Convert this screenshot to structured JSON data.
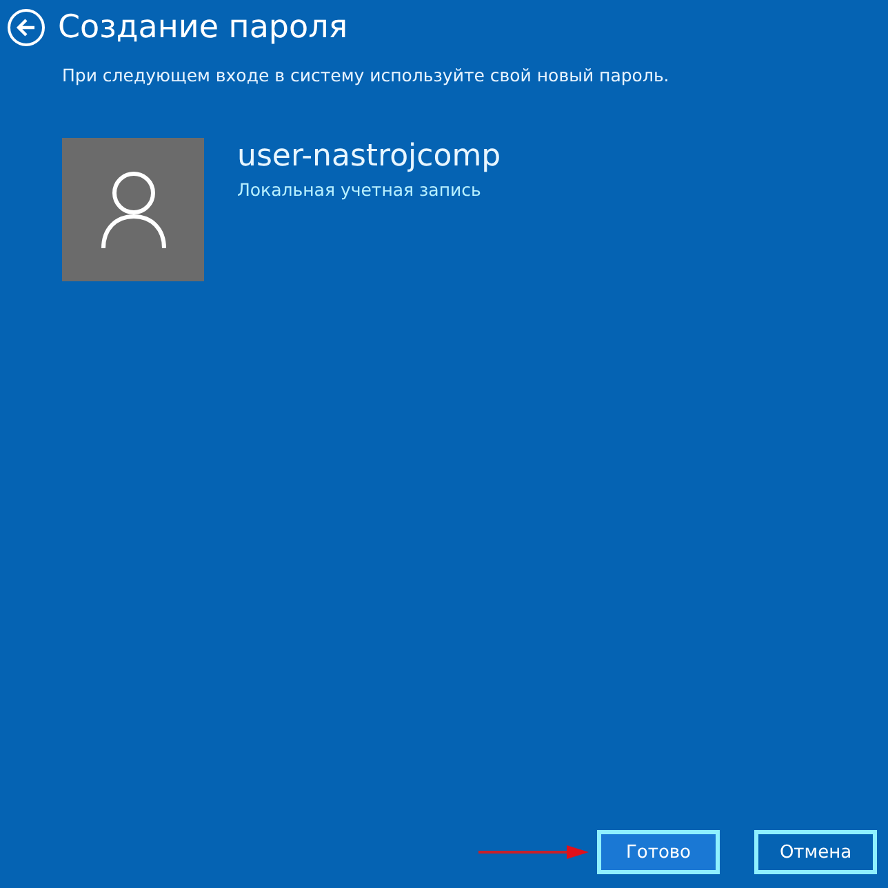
{
  "header": {
    "title": "Создание пароля"
  },
  "message": "При следующем входе в систему используйте свой новый пароль.",
  "account": {
    "name": "user-nastrojcomp",
    "type": "Локальная учетная запись"
  },
  "buttons": [
    {
      "label": "Готово",
      "kind": "primary"
    },
    {
      "label": "Отмена",
      "kind": "secondary"
    }
  ]
}
